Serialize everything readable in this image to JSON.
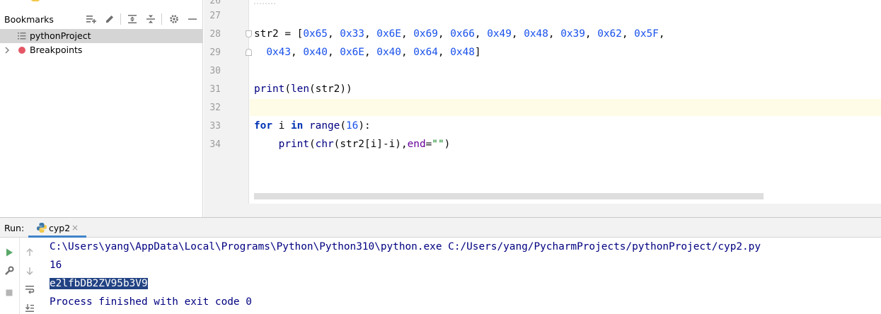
{
  "bookmarks": {
    "title": "Bookmarks",
    "toolbar": [
      {
        "name": "add-group-icon",
        "glyph": "add-list"
      },
      {
        "name": "edit-icon",
        "glyph": "pencil"
      },
      {
        "name": "expand-all-icon",
        "glyph": "expand"
      },
      {
        "name": "collapse-all-icon",
        "glyph": "collapse"
      },
      {
        "name": "gear-icon",
        "glyph": "settings"
      },
      {
        "name": "hide-icon",
        "glyph": "minus"
      }
    ],
    "items": [
      {
        "label": "pythonProject",
        "icon": "list-icon",
        "selected": true
      },
      {
        "label": "Breakpoints",
        "icon": "breakpoint-icon",
        "expanded": false
      }
    ]
  },
  "editor": {
    "partial_line_number": "26",
    "lines": [
      {
        "number": "27",
        "text": ""
      },
      {
        "number": "28",
        "text": "str2 = [0x65, 0x33, 0x6E, 0x69, 0x66, 0x49, 0x48, 0x39, 0x62, 0x5F,"
      },
      {
        "number": "29",
        "text": "  0x43, 0x40, 0x6E, 0x40, 0x64, 0x48]"
      },
      {
        "number": "30",
        "text": ""
      },
      {
        "number": "31",
        "text": "print(len(str2))"
      },
      {
        "number": "32",
        "text": ""
      },
      {
        "number": "33",
        "text": "for i in range(16):"
      },
      {
        "number": "34",
        "text": "    print(chr(str2[i]-i),end=\"\")"
      }
    ],
    "current_line": "32",
    "colors": {
      "keyword": "#0033b3",
      "number": "#1750eb",
      "string": "#067d17",
      "kwarg": "#660099",
      "function": "#000080",
      "current_line_bg": "#fefbe6"
    }
  },
  "run": {
    "label": "Run:",
    "tab_label": "cyp2",
    "tab_close": "×",
    "output": [
      "C:\\Users\\yang\\AppData\\Local\\Programs\\Python\\Python310\\python.exe C:/Users/yang/PycharmProjects/pythonProject/cyp2.py",
      "16",
      "e2lfbDB2ZV95b3V9",
      "Process finished with exit code 0"
    ],
    "selected_output_index": 2,
    "toolbar": [
      "run-icon",
      "rerun-up-icon",
      "wrench-icon",
      "down-arrow-icon",
      "stop-icon",
      "soft-wrap-icon",
      "pin-icon",
      "scroll-end-icon"
    ],
    "colors": {
      "output_text": "#000080",
      "selection_bg": "#214283",
      "tab_underline": "#4083c9",
      "run_green": "#59a869"
    }
  }
}
